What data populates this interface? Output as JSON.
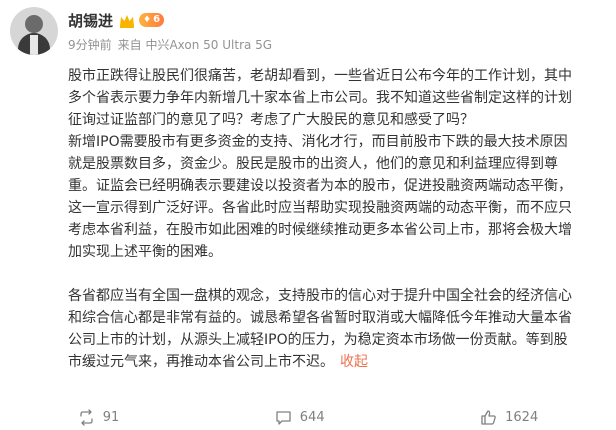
{
  "author": {
    "name": "胡锡进",
    "vip_icon": "vip-crown-icon",
    "level_badge": "6"
  },
  "meta": {
    "time": "9分钟前",
    "source": "来自 中兴Axon 50 Ultra 5G"
  },
  "content": {
    "paragraph1_lines": [
      "股市正跌得让股民们很痛苦，老胡却看到，一些省近日公布今年的工作计划，其中",
      "多个省表示要力争年内新增几十家本省上市公司。我不知道这些省制定这样的计划",
      "征询过证监部门的意见了吗？考虑了广大股民的意见和感受了吗？",
      "新增IPO需要股市有更多资金的支持、消化才行，而目前股市下跌的最大技术原因",
      "就是股票数目多，资金少。股民是股市的出资人，他们的意见和利益理应得到尊",
      "重。证监会已经明确表示要建设以投资者为本的股市，促进投融资两端动态平衡，",
      "这一宣示得到广泛好评。各省此时应当帮助实现投融资两端的动态平衡，而不应只",
      "考虑本省利益，在股市如此困难的时候继续推动更多本省公司上市，那将会极大增",
      "加实现上述平衡的困难。"
    ],
    "paragraph2_lines": [
      "各省都应当有全国一盘棋的观念，支持股市的信心对于提升中国全社会的经济信心",
      "和综合信心都是非常有益的。诚恳希望各省暂时取消或大幅降低今年推动大量本省",
      "公司上市的计划，从源头上减轻IPO的压力，为稳定资本市场做一份贡献。等到股",
      "市缓过元气来，再推动本省公司上市不迟。"
    ],
    "collapse_label": "收起"
  },
  "footer": {
    "repost_count": "91",
    "comment_count": "644",
    "like_count": "1624"
  }
}
